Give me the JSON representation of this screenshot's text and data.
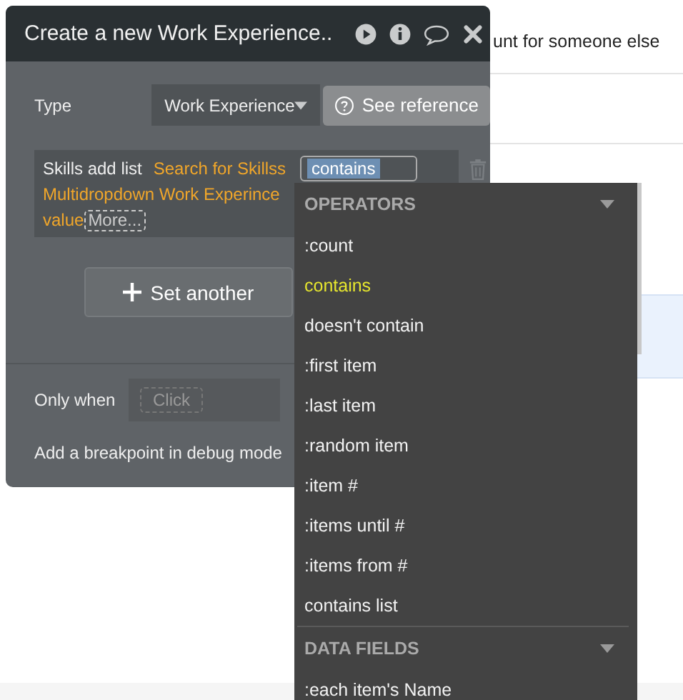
{
  "background": {
    "heading": "unt for someone else"
  },
  "dialog": {
    "title": "Create a new Work Experience..",
    "type": {
      "label": "Type",
      "value": "Work Experience",
      "reference": "See reference"
    },
    "field": {
      "name": "Skills add list",
      "expression": [
        "Search for Skillss",
        "Multidropdown Work Experince",
        "value"
      ],
      "operator": "contains",
      "more": "More..."
    },
    "set_another": "Set another",
    "only_when": {
      "label": "Only when",
      "placeholder": "Click"
    },
    "breakpoint": "Add a breakpoint in debug mode"
  },
  "dropdown": {
    "sections": [
      {
        "title": "OPERATORS",
        "items": [
          {
            "label": ":count",
            "selected": false
          },
          {
            "label": "contains",
            "selected": true
          },
          {
            "label": "doesn't contain",
            "selected": false
          },
          {
            "label": ":first item",
            "selected": false
          },
          {
            "label": ":last item",
            "selected": false
          },
          {
            "label": ":random item",
            "selected": false
          },
          {
            "label": ":item #",
            "selected": false
          },
          {
            "label": ":items until #",
            "selected": false
          },
          {
            "label": ":items from #",
            "selected": false
          },
          {
            "label": "contains list",
            "selected": false
          }
        ]
      },
      {
        "title": "DATA FIELDS",
        "items": [
          {
            "label": ":each item's Name",
            "selected": false
          }
        ]
      }
    ]
  }
}
